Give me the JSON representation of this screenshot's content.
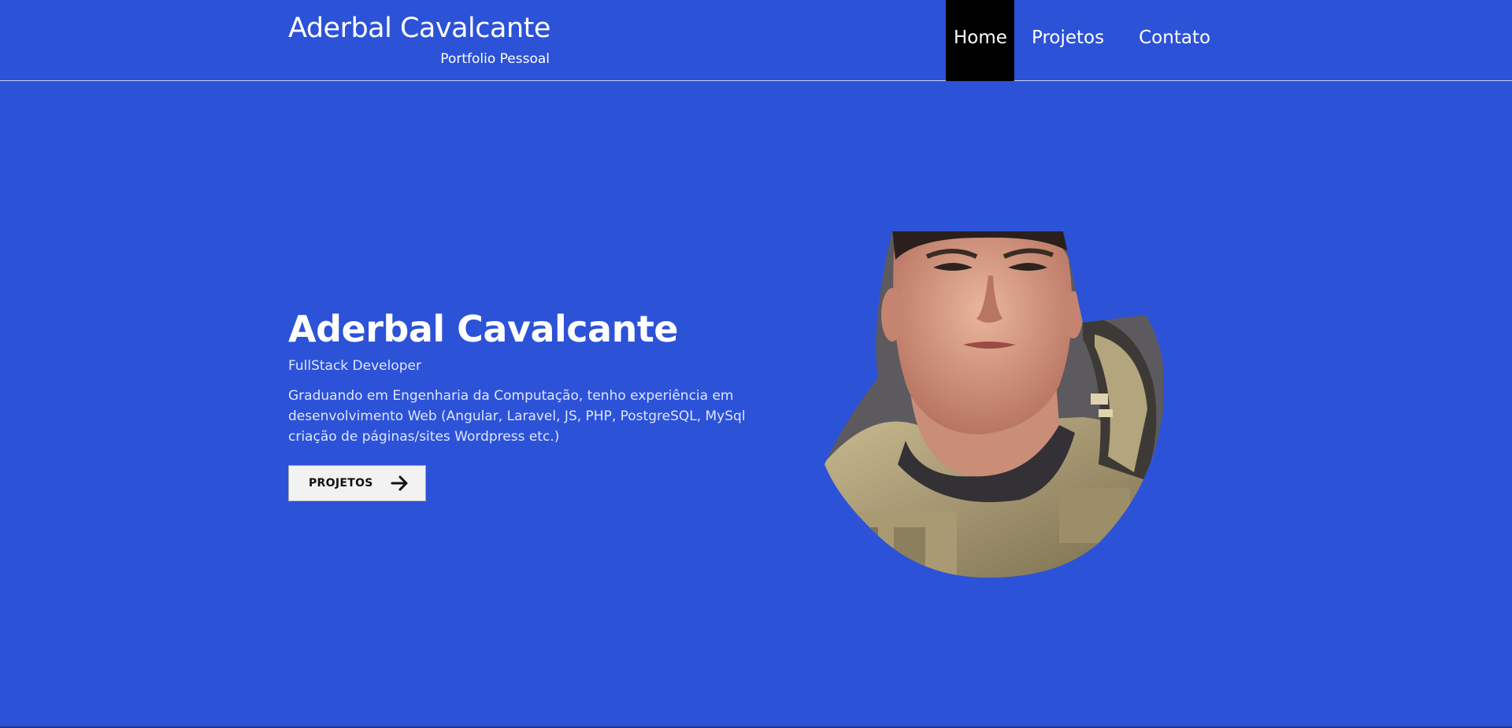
{
  "header": {
    "brand_title": "Aderbal Cavalcante",
    "brand_subtitle": "Portfolio Pessoal"
  },
  "nav": {
    "items": [
      {
        "label": "Home",
        "active": true
      },
      {
        "label": "Projetos",
        "active": false
      },
      {
        "label": "Contato",
        "active": false
      }
    ]
  },
  "hero": {
    "name": "Aderbal Cavalcante",
    "role": "FullStack Developer",
    "description_lines": [
      "Graduando em Engenharia da Computação, tenho experiência em",
      "desenvolvimento Web (Angular, Laravel, JS, PHP, PostgreSQL, MySql",
      "criação de páginas/sites Wordpress etc.)"
    ],
    "cta_label": "PROJETOS",
    "cta_icon": "arrow-right-icon",
    "portrait_icon": "profile-portrait"
  },
  "colors": {
    "background": "#2c52d8",
    "nav_active_bg": "#000000",
    "button_bg": "#f2f2f2",
    "text": "#ffffff"
  }
}
